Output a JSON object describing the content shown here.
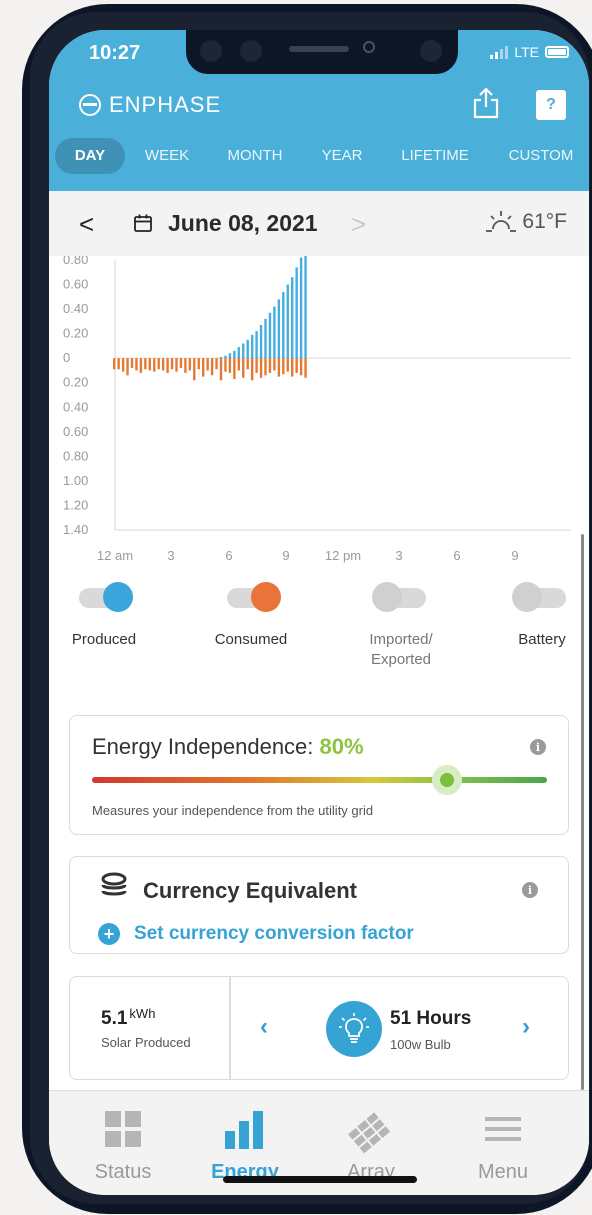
{
  "status_bar": {
    "time": "10:27",
    "network": "LTE"
  },
  "app": {
    "brand": "ENPHASE",
    "help_label": "?"
  },
  "tabs": [
    {
      "label": "DAY",
      "active": true
    },
    {
      "label": "WEEK",
      "active": false
    },
    {
      "label": "MONTH",
      "active": false
    },
    {
      "label": "YEAR",
      "active": false
    },
    {
      "label": "LIFETIME",
      "active": false
    },
    {
      "label": "CUSTOM",
      "active": false
    }
  ],
  "date_nav": {
    "back_glyph": "<",
    "date": "June 08, 2021",
    "forward_glyph": ">",
    "temperature": "61°F"
  },
  "chart_data": {
    "type": "bar",
    "y_ticks": [
      "0.80",
      "0.60",
      "0.40",
      "0.20",
      "0",
      "0.20",
      "0.40",
      "0.60",
      "0.80",
      "1.00",
      "1.20",
      "1.40"
    ],
    "x_ticks": [
      "12 am",
      "3",
      "6",
      "9",
      "12 pm",
      "3",
      "6",
      "9"
    ],
    "ylim": [
      -1.4,
      0.8
    ],
    "series": [
      {
        "name": "Produced",
        "color": "#45aee0",
        "values": [
          0,
          0,
          0,
          0,
          0,
          0,
          0,
          0,
          0,
          0,
          0,
          0,
          0,
          0,
          0,
          0,
          0,
          0,
          0,
          0,
          0,
          0,
          0,
          0,
          0.01,
          0.02,
          0.04,
          0.06,
          0.09,
          0.12,
          0.15,
          0.19,
          0.22,
          0.27,
          0.32,
          0.37,
          0.42,
          0.48,
          0.54,
          0.6,
          0.66,
          0.74,
          0.82,
          0.85
        ]
      },
      {
        "name": "Consumed",
        "color": "#e47934",
        "values": [
          -0.09,
          -0.09,
          -0.11,
          -0.14,
          -0.08,
          -0.1,
          -0.12,
          -0.09,
          -0.1,
          -0.11,
          -0.09,
          -0.1,
          -0.12,
          -0.09,
          -0.11,
          -0.08,
          -0.12,
          -0.1,
          -0.18,
          -0.09,
          -0.15,
          -0.1,
          -0.14,
          -0.09,
          -0.18,
          -0.11,
          -0.12,
          -0.17,
          -0.1,
          -0.16,
          -0.09,
          -0.18,
          -0.12,
          -0.16,
          -0.14,
          -0.12,
          -0.1,
          -0.15,
          -0.13,
          -0.11,
          -0.15,
          -0.12,
          -0.14,
          -0.16
        ]
      }
    ]
  },
  "toggles": [
    {
      "label": "Produced",
      "on": true,
      "color": "#3aa6dc"
    },
    {
      "label": "Consumed",
      "on": true,
      "color": "#e8743b"
    },
    {
      "label_line1": "Imported/",
      "label_line2": "Exported",
      "on": false,
      "color": "#d0d0d0"
    },
    {
      "label": "Battery",
      "on": false,
      "color": "#d0d0d0"
    }
  ],
  "energy_independence": {
    "title": "Energy Independence:",
    "percent": "80%",
    "description": "Measures your independence from the utility grid",
    "info_glyph": "i"
  },
  "currency": {
    "title": "Currency Equivalent",
    "link": "Set currency conversion factor",
    "info_glyph": "i",
    "plus_glyph": "+"
  },
  "equivalent": {
    "value": "5.1",
    "unit": "kWh",
    "value_label": "Solar Produced",
    "prev_glyph": "‹",
    "next_glyph": "›",
    "hours": "51 Hours",
    "bulb": "100w Bulb"
  },
  "bottom_nav": [
    {
      "label": "Status",
      "icon": "grid-icon",
      "active": false
    },
    {
      "label": "Energy",
      "icon": "bar-chart-icon",
      "active": true
    },
    {
      "label": "Array",
      "icon": "solar-panel-icon",
      "active": false
    },
    {
      "label": "Menu",
      "icon": "hamburger-icon",
      "active": false
    }
  ]
}
